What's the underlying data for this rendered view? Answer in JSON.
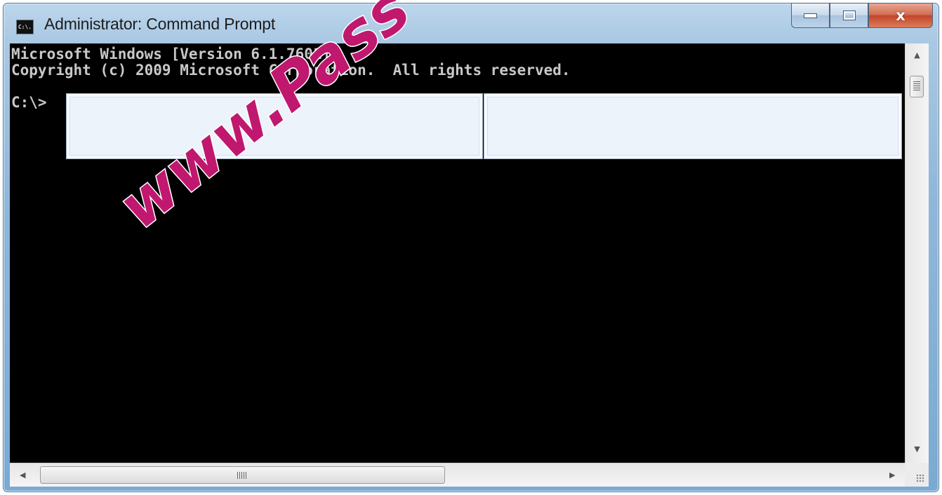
{
  "window": {
    "title": "Administrator: Command Prompt",
    "icon": "cmd-icon",
    "icon_text": "C:\\.",
    "controls": {
      "minimize": "minimize-icon",
      "maximize": "maximize-icon",
      "close": "close-icon",
      "close_glyph": "x"
    }
  },
  "console": {
    "lines": [
      "Microsoft Windows [Version 6.1.7601]",
      "Copyright (c) 2009 Microsoft Corporation.  All rights reserved."
    ],
    "prompt": "C:\\>",
    "answer_boxes": [
      "",
      ""
    ]
  },
  "scrollbars": {
    "horizontal_grip": "III"
  },
  "watermark": {
    "text": "www.Pass",
    "color": "#c0186e"
  },
  "colors": {
    "console_bg": "#000000",
    "console_text": "#c8c8c8",
    "answer_box": "#edf3fb",
    "close_button": "#c7452b",
    "title_bar": "#a9c8e3"
  }
}
